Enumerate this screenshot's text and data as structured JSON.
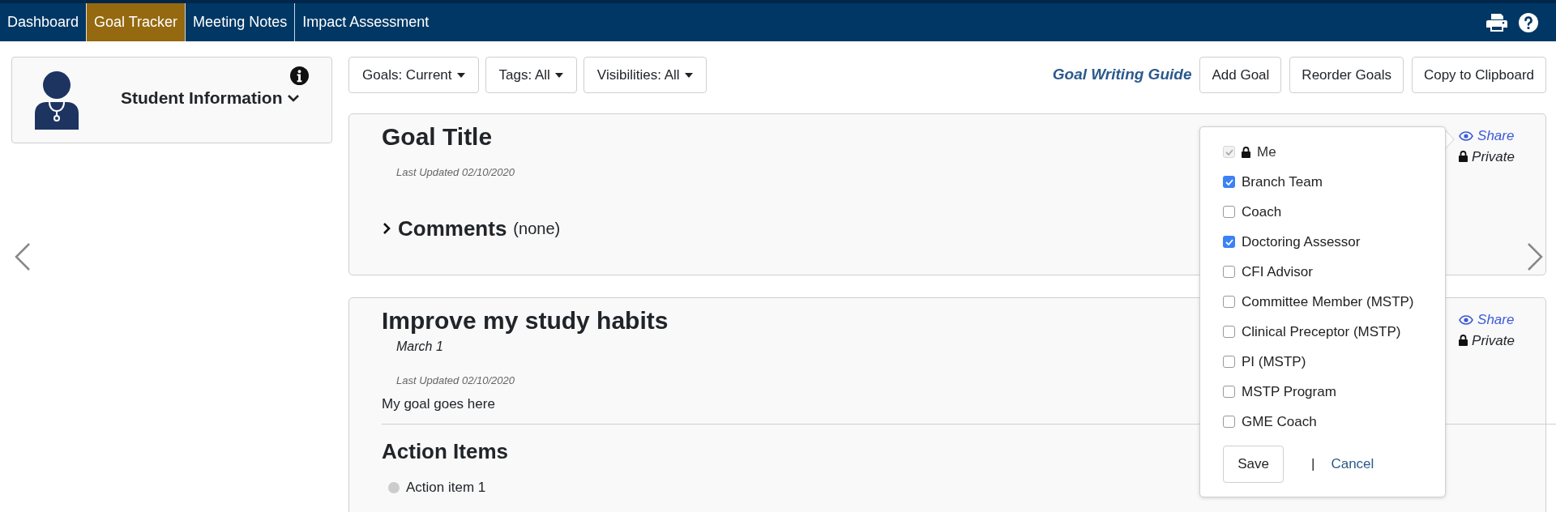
{
  "nav": {
    "tabs": [
      {
        "label": "Dashboard",
        "selected": false
      },
      {
        "label": "Goal Tracker",
        "selected": true
      },
      {
        "label": "Meeting Notes",
        "selected": false
      },
      {
        "label": "Impact Assessment",
        "selected": false
      }
    ]
  },
  "student_panel": {
    "title": "Student Information",
    "expanded": false
  },
  "toolbar": {
    "filters": [
      "Goals: Current",
      "Tags: All",
      "Visibilities: All"
    ],
    "guide_link": "Goal Writing Guide",
    "buttons": [
      "Add Goal",
      "Reorder Goals",
      "Copy to Clipboard"
    ]
  },
  "goals": [
    {
      "title": "Goal Title",
      "updated": "Last Updated 02/10/2020",
      "share": "Share",
      "privacy": "Private",
      "comments": {
        "label": "Comments",
        "count": "(none)",
        "expanded": false
      }
    },
    {
      "title": "Improve my study habits",
      "date": "March 1",
      "updated": "Last Updated 02/10/2020",
      "description": "My goal goes here",
      "share": "Share",
      "privacy": "Private",
      "action_items_heading": "Action Items",
      "action_items": [
        "Action item 1"
      ]
    }
  ],
  "share_popover": {
    "options": [
      {
        "label": "Me",
        "checked": true,
        "disabled": true,
        "locked": true
      },
      {
        "label": "Branch Team",
        "checked": true,
        "disabled": false,
        "locked": false
      },
      {
        "label": "Coach",
        "checked": false,
        "disabled": false,
        "locked": false
      },
      {
        "label": "Doctoring Assessor",
        "checked": true,
        "disabled": false,
        "locked": false
      },
      {
        "label": "CFI Advisor",
        "checked": false,
        "disabled": false,
        "locked": false
      },
      {
        "label": "Committee Member (MSTP)",
        "checked": false,
        "disabled": false,
        "locked": false
      },
      {
        "label": "Clinical Preceptor (MSTP)",
        "checked": false,
        "disabled": false,
        "locked": false
      },
      {
        "label": "PI (MSTP)",
        "checked": false,
        "disabled": false,
        "locked": false
      },
      {
        "label": "MSTP Program",
        "checked": false,
        "disabled": false,
        "locked": false
      },
      {
        "label": "GME Coach",
        "checked": false,
        "disabled": false,
        "locked": false
      }
    ],
    "save": "Save",
    "separator": "|",
    "cancel": "Cancel"
  }
}
